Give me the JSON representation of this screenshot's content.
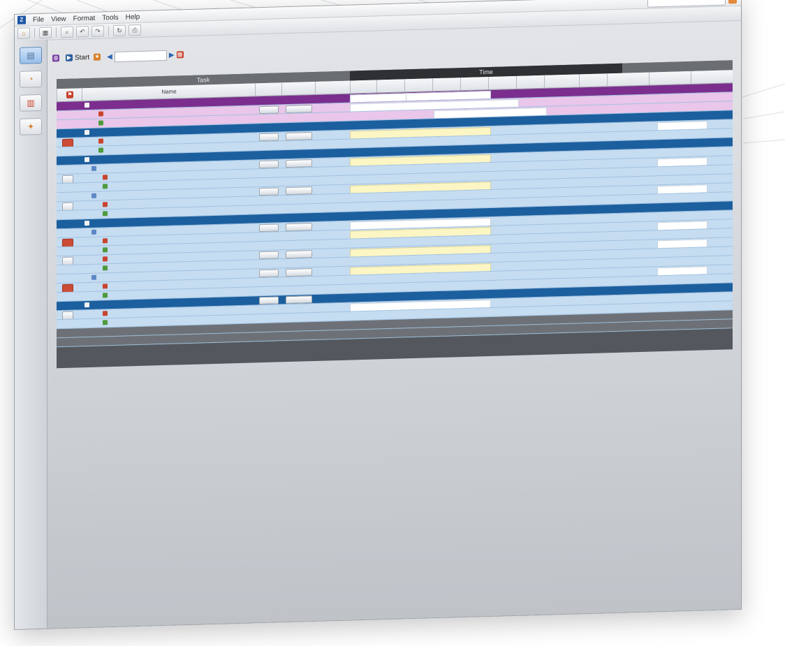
{
  "menubar": {
    "items": [
      "File",
      "View",
      "Format",
      "Tools",
      "Help"
    ]
  },
  "breadcrumb": "",
  "toolbar2": {
    "first_label": "",
    "second_label": "Start",
    "third_label": "",
    "date_value": ""
  },
  "grid": {
    "group_headers": [
      "Task",
      "Time",
      ""
    ],
    "columns": [
      "Name",
      "",
      "",
      "",
      "",
      "",
      "",
      "",
      "",
      "",
      "",
      "",
      "",
      "",
      "",
      "",
      ""
    ],
    "totals_label": "",
    "tasks_label": ""
  },
  "rows": [
    {
      "kind": "purple",
      "name": ""
    },
    {
      "kind": "lilac",
      "name": ""
    },
    {
      "kind": "lilac",
      "name": ""
    },
    {
      "kind": "blue",
      "name": ""
    },
    {
      "kind": "light",
      "name": ""
    },
    {
      "kind": "light",
      "name": ""
    },
    {
      "kind": "blue",
      "name": ""
    },
    {
      "kind": "light",
      "name": ""
    },
    {
      "kind": "light",
      "name": ""
    },
    {
      "kind": "light",
      "name": ""
    },
    {
      "kind": "light",
      "name": ""
    },
    {
      "kind": "light",
      "name": ""
    },
    {
      "kind": "light",
      "name": ""
    },
    {
      "kind": "blue",
      "name": ""
    },
    {
      "kind": "light",
      "name": ""
    },
    {
      "kind": "light",
      "name": ""
    },
    {
      "kind": "light",
      "name": ""
    },
    {
      "kind": "light",
      "name": ""
    },
    {
      "kind": "light",
      "name": ""
    },
    {
      "kind": "light",
      "name": ""
    },
    {
      "kind": "light",
      "name": ""
    },
    {
      "kind": "light",
      "name": ""
    },
    {
      "kind": "blue",
      "name": ""
    },
    {
      "kind": "light",
      "name": ""
    },
    {
      "kind": "light",
      "name": ""
    },
    {
      "kind": "gray",
      "name": ""
    }
  ],
  "colors": {
    "purple": "#7b2e8e",
    "lilac": "#e9c6ea",
    "blue": "#1c5f9e",
    "light": "#c5dcf1",
    "gray": "#54585e"
  },
  "icons": {
    "app": "app-icon",
    "home": "home-icon",
    "calendar": "calendar-icon",
    "chart": "chart-icon",
    "settings": "settings-icon"
  }
}
